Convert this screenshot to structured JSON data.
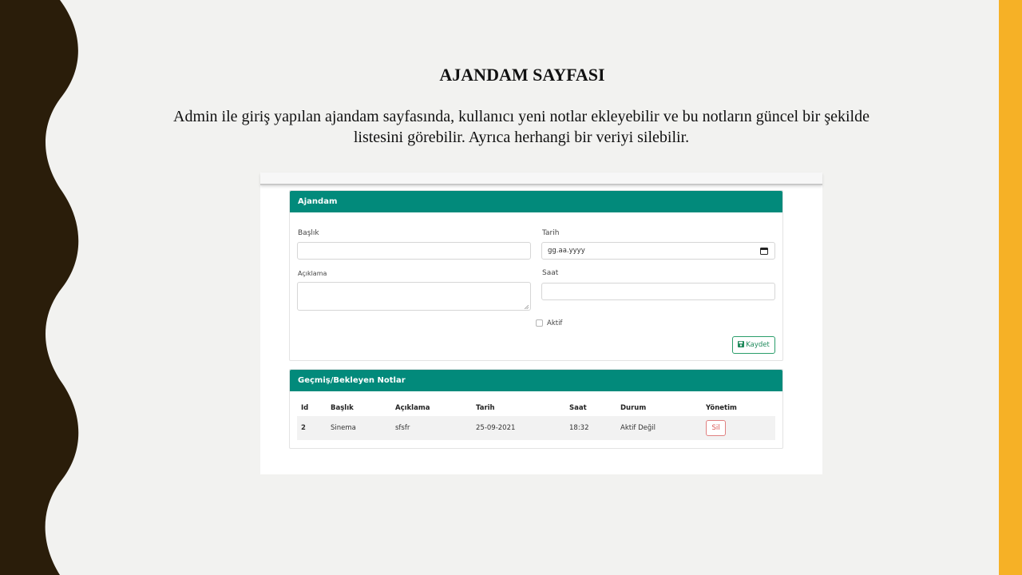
{
  "slide": {
    "title": "AJANDAM SAYFASI",
    "description": "Admin ile giriş yapılan ajandam sayfasında, kullanıcı yeni notlar ekleyebilir ve bu notların güncel bir şekilde listesini görebilir. Ayrıca herhangi bir veriyi silebilir.",
    "colors": {
      "wave": "#2a1d0a",
      "right_band": "#f6b126",
      "background": "#f2f2f0"
    }
  },
  "app": {
    "accent_color": "#028a7b",
    "form": {
      "header": "Ajandam",
      "baslik_label": "Başlık",
      "baslik_value": "",
      "tarih_label": "Tarih",
      "tarih_value": "gg.aa.yyyy",
      "aciklama_label": "Açıklama",
      "aciklama_value": "",
      "saat_label": "Saat",
      "saat_value": "",
      "aktif_label": "Aktif",
      "aktif_checked": false,
      "save_label": "Kaydet",
      "save_icon": "floppy-disk-icon",
      "date_icon": "calendar-icon"
    },
    "notes": {
      "header": "Geçmiş/Bekleyen Notlar",
      "columns": [
        "Id",
        "Başlık",
        "Açıklama",
        "Tarih",
        "Saat",
        "Durum",
        "Yönetim"
      ],
      "rows": [
        {
          "id": "2",
          "baslik": "Sinema",
          "aciklama": "sfsfr",
          "tarih": "25-09-2021",
          "saat": "18:32",
          "durum": "Aktif Değil",
          "action": "Sil"
        }
      ]
    }
  }
}
